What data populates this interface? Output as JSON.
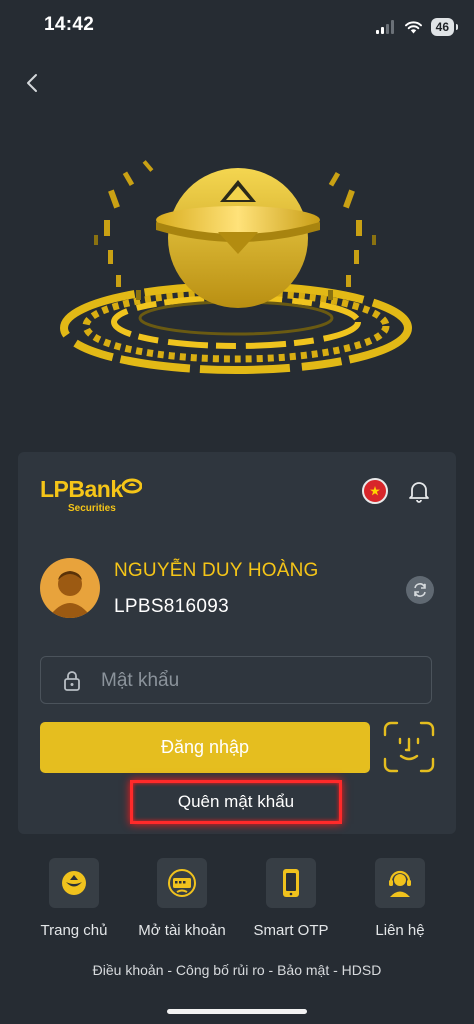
{
  "status_bar": {
    "time": "14:42",
    "battery": "46"
  },
  "brand": {
    "name": "LPBank",
    "sub": "Securities",
    "accent": "#f5c518"
  },
  "user": {
    "name": "NGUYỄN DUY HOÀNG",
    "account_id": "LPBS816093"
  },
  "password": {
    "placeholder": "Mật khẩu",
    "value": ""
  },
  "actions": {
    "login": "Đăng nhập",
    "forgot_password": "Quên mật khẩu"
  },
  "nav": [
    {
      "label": "Trang chủ",
      "icon": "home-coin-icon"
    },
    {
      "label": "Mở tài khoản",
      "icon": "open-account-icon"
    },
    {
      "label": "Smart OTP",
      "icon": "smartphone-icon"
    },
    {
      "label": "Liên hệ",
      "icon": "support-agent-icon"
    }
  ],
  "footer": {
    "links": "Điều khoản - Công bố rủi ro - Bảo mật - HDSD"
  },
  "colors": {
    "background": "#262c33",
    "card": "#2f363e",
    "button": "#e5be1f",
    "highlight": "#ff2a2a"
  }
}
